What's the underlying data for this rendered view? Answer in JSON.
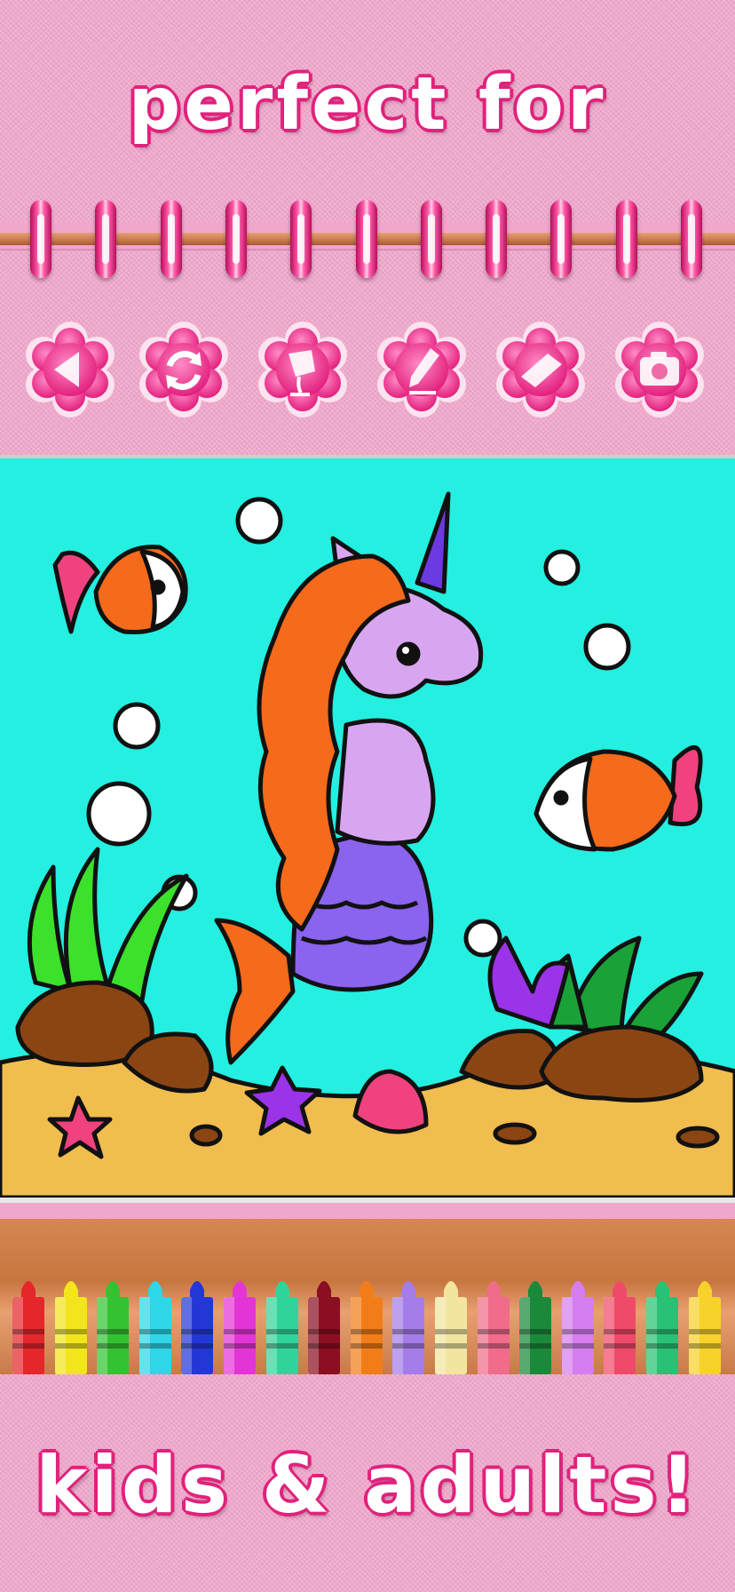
{
  "headline_top": "perfect for",
  "headline_bottom": "kids & adults!",
  "toolbar": {
    "tools": [
      {
        "name": "back",
        "icon": "back-triangle-icon"
      },
      {
        "name": "undo",
        "icon": "undo-arrows-icon"
      },
      {
        "name": "fill",
        "icon": "paint-bucket-icon"
      },
      {
        "name": "pencil",
        "icon": "pencil-icon"
      },
      {
        "name": "eraser",
        "icon": "eraser-icon"
      },
      {
        "name": "camera",
        "icon": "camera-icon"
      }
    ]
  },
  "crayons": [
    "#e5262b",
    "#f2e51c",
    "#35c232",
    "#2ed6e8",
    "#2437d6",
    "#e335d6",
    "#30d49a",
    "#8c0e22",
    "#f27d18",
    "#a57de8",
    "#f3e5a0",
    "#f06c8a",
    "#1a8a3a",
    "#d67df0",
    "#f04a6a",
    "#29c274",
    "#f7d22a"
  ],
  "colors": {
    "pink_bg": "#f3a9ce",
    "headline_outline": "#e0237d",
    "water": "#24efe0",
    "sand": "#f0bd4e"
  }
}
